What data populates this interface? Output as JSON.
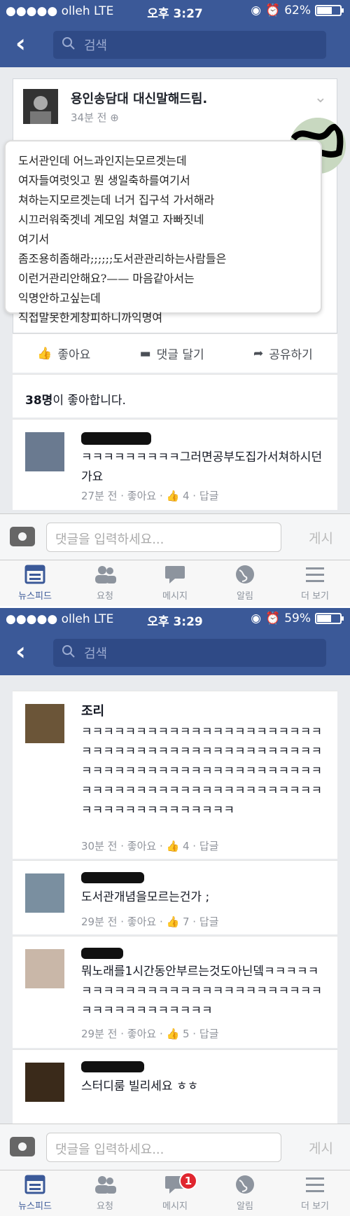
{
  "screen1": {
    "status": {
      "carrier": "●●●●● olleh  LTE",
      "time": "오후 3:27",
      "battery": "62%",
      "battery_level": 0.62
    },
    "search_placeholder": "검색",
    "post": {
      "author": "용인송담대 대신말해드림.",
      "time": "34분 전",
      "lines": [
        "도서관인데 어느과인지는모르겟는데",
        "여자들여럿잇고 뭔 생일축하를여기서",
        "쳐하는지모르겟는데 너거 집구석 가서해라",
        "시끄러워죽겟네 계모임 쳐열고 자빠짓네",
        "여기서",
        "좀조용히좀해라;;;;;;도서관관리하는사람들은",
        "이런거관리안해요?—— 마음같아서는",
        "익명안하고싶는데",
        "직접말못한게창피하니까익명여"
      ]
    },
    "actions": {
      "like": "좋아요",
      "comment": "댓글 달기",
      "share": "공유하기"
    },
    "likes_count": "38명",
    "likes_suffix": "이 좋아합니다.",
    "comments": [
      {
        "text": "ㅋㅋㅋㅋㅋㅋㅋㅋㅋ그러면공부도집가서쳐하시던가요",
        "time": "27분 전",
        "like_link": "좋아요",
        "likes": "4",
        "reply": "답글"
      }
    ],
    "input_placeholder": "댓글을 입력하세요...",
    "post_button": "게시",
    "tabs": [
      {
        "label": "뉴스피드"
      },
      {
        "label": "요청"
      },
      {
        "label": "메시지"
      },
      {
        "label": "알림"
      },
      {
        "label": "더 보기"
      }
    ]
  },
  "screen2": {
    "status": {
      "carrier": "●●●●● olleh  LTE",
      "time": "오후 3:29",
      "battery": "59%",
      "battery_level": 0.59
    },
    "search_placeholder": "검색",
    "comments": [
      {
        "name": "조리",
        "text": "ㅋㅋㅋㅋㅋㅋㅋㅋㅋㅋㅋㅋㅋㅋㅋㅋㅋㅋㅋㅋㅋㅋㅋㅋㅋㅋㅋㅋㅋㅋㅋㅋㅋㅋㅋㅋㅋㅋㅋㅋㅋㅋㅋㅋㅋㅋㅋㅋㅋㅋㅋㅋㅋㅋㅋㅋㅋㅋㅋㅋㅋㅋㅋㅋㅋㅋㅋㅋㅋㅋㅋㅋㅋㅋㅋㅋㅋㅋㅋㅋㅋㅋㅋㅋㅋㅋㅋㅋㅋㅋㅋㅋㅋㅋㅋㅋㅋㅋㅋㅋㅋㅋ",
        "time": "30분 전",
        "like_link": "좋아요",
        "likes": "4",
        "reply": "답글"
      },
      {
        "name": "",
        "text": "도서관개념을모르는건가 ;",
        "time": "29분 전",
        "like_link": "좋아요",
        "likes": "7",
        "reply": "답글"
      },
      {
        "name": "",
        "text": "뭐노래를1시간동안부르는것도아닌뎈ㅋㅋㅋㅋㅋㅋㅋㅋㅋㅋㅋㅋㅋㅋㅋㅋㅋㅋㅋㅋㅋㅋㅋㅋㅋㅋㅋㅋㅋㅋㅋㅋㅋㅋㅋㅋㅋㅋㅋ",
        "time": "29분 전",
        "like_link": "좋아요",
        "likes": "5",
        "reply": "답글"
      },
      {
        "name": "",
        "text": "스터디룸 빌리세요 ㅎㅎ",
        "time": "",
        "like_link": "",
        "likes": "",
        "reply": ""
      }
    ],
    "input_placeholder": "댓글을 입력하세요...",
    "post_button": "게시",
    "tabs": [
      {
        "label": "뉴스피드"
      },
      {
        "label": "요청"
      },
      {
        "label": "메시지",
        "badge": "1"
      },
      {
        "label": "알림"
      },
      {
        "label": "더 보기"
      }
    ]
  }
}
